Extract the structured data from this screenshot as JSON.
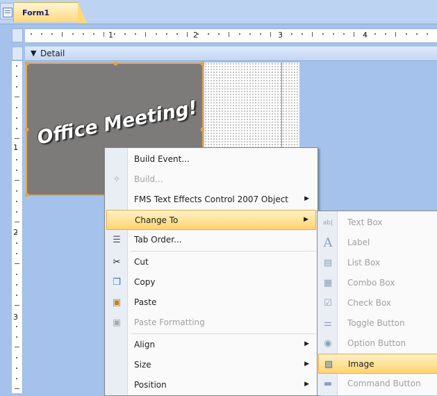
{
  "tab": {
    "title": "Form1",
    "icon": "form-icon"
  },
  "ruler": {
    "h_numbers": [
      "1",
      "2",
      "3",
      "4"
    ],
    "v_numbers": [
      "1",
      "2",
      "3"
    ]
  },
  "section": {
    "label": "Detail"
  },
  "image_control": {
    "text": "Office Meeting!"
  },
  "context_menu": {
    "items": [
      {
        "label": "Build Event...",
        "icon": "",
        "enabled": true,
        "submenu": false
      },
      {
        "label": "Build...",
        "icon": "build-icon",
        "enabled": false,
        "submenu": false
      },
      {
        "label": "FMS Text Effects Control 2007 Object",
        "icon": "",
        "enabled": true,
        "submenu": true
      },
      {
        "label": "Change To",
        "icon": "",
        "enabled": true,
        "submenu": true,
        "highlighted": true
      },
      {
        "label": "Tab Order...",
        "icon": "tab-order-icon",
        "enabled": true,
        "submenu": false
      },
      {
        "label": "Cut",
        "icon": "scissors-icon",
        "enabled": true,
        "submenu": false
      },
      {
        "label": "Copy",
        "icon": "copy-icon",
        "enabled": true,
        "submenu": false
      },
      {
        "label": "Paste",
        "icon": "paste-icon",
        "enabled": true,
        "submenu": false
      },
      {
        "label": "Paste Formatting",
        "icon": "paste-formatting-icon",
        "enabled": false,
        "submenu": false
      },
      {
        "label": "Align",
        "icon": "",
        "enabled": true,
        "submenu": true
      },
      {
        "label": "Size",
        "icon": "",
        "enabled": true,
        "submenu": true
      },
      {
        "label": "Position",
        "icon": "",
        "enabled": true,
        "submenu": true
      }
    ]
  },
  "change_to_menu": {
    "items": [
      {
        "label": "Text Box",
        "icon": "text-box-icon",
        "enabled": false
      },
      {
        "label": "Label",
        "icon": "label-icon",
        "enabled": false
      },
      {
        "label": "List Box",
        "icon": "list-box-icon",
        "enabled": false
      },
      {
        "label": "Combo Box",
        "icon": "combo-box-icon",
        "enabled": false
      },
      {
        "label": "Check Box",
        "icon": "check-box-icon",
        "enabled": false
      },
      {
        "label": "Toggle Button",
        "icon": "toggle-button-icon",
        "enabled": false
      },
      {
        "label": "Option Button",
        "icon": "option-button-icon",
        "enabled": false
      },
      {
        "label": "Image",
        "icon": "image-icon",
        "enabled": true,
        "highlighted": true
      },
      {
        "label": "Command Button",
        "icon": "command-button-icon",
        "enabled": false
      }
    ]
  },
  "colors": {
    "background": "#a4c2eb",
    "highlight": "#ffd46f",
    "image_fill": "#7d7b7a",
    "selection": "#e2a34f"
  }
}
